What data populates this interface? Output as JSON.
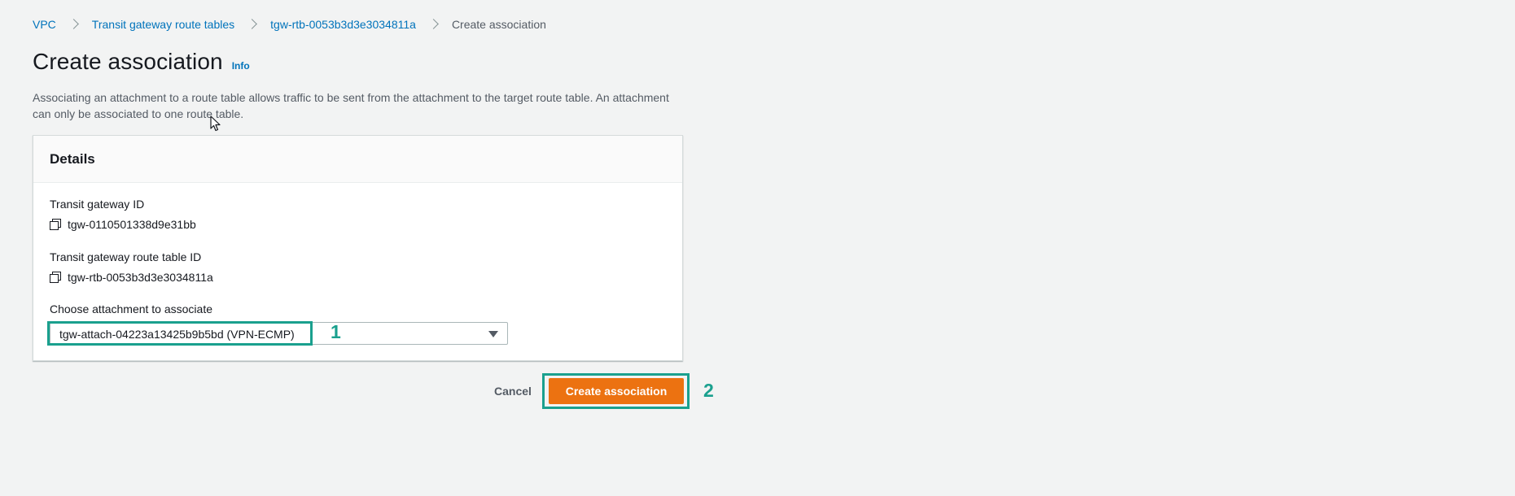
{
  "breadcrumb": {
    "items": [
      {
        "label": "VPC"
      },
      {
        "label": "Transit gateway route tables"
      },
      {
        "label": "tgw-rtb-0053b3d3e3034811a"
      }
    ],
    "current": "Create association"
  },
  "header": {
    "title": "Create association",
    "info_label": "Info",
    "description": "Associating an attachment to a route table allows traffic to be sent from the attachment to the target route table. An attachment can only be associated to one route table."
  },
  "details": {
    "title": "Details",
    "transit_gateway_id_label": "Transit gateway ID",
    "transit_gateway_id_value": "tgw-0110501338d9e31bb",
    "route_table_id_label": "Transit gateway route table ID",
    "route_table_id_value": "tgw-rtb-0053b3d3e3034811a",
    "attachment_label": "Choose attachment to associate",
    "attachment_selected": "tgw-attach-04223a13425b9b5bd (VPN-ECMP)"
  },
  "actions": {
    "cancel_label": "Cancel",
    "submit_label": "Create association"
  },
  "annotations": {
    "step1": "1",
    "step2": "2"
  },
  "colors": {
    "link": "#0073bb",
    "primary_button": "#ec7211",
    "annotation": "#1aa08e",
    "background": "#f2f3f3"
  },
  "icons": [
    "chevron-right-icon",
    "copy-icon",
    "caret-down-icon",
    "mouse-cursor"
  ]
}
